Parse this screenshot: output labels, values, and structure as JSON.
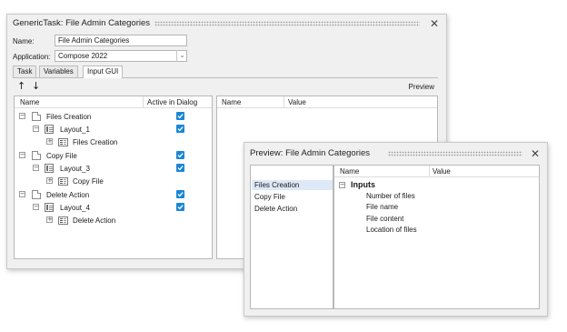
{
  "main_window": {
    "title": "GenericTask: File Admin Categories",
    "name_label": "Name:",
    "name_value": "File Admin Categories",
    "application_label": "Application:",
    "application_value": "Compose 2022",
    "tabs": [
      "Task",
      "Variables",
      "Input GUI"
    ],
    "active_tab": "Input GUI",
    "up_arrow": "↑",
    "down_arrow": "↓",
    "preview_label": "Preview",
    "tree_headers": {
      "name": "Name",
      "active": "Active in Dialog"
    },
    "tree": [
      {
        "label": "Files Creation",
        "checked": true
      },
      {
        "label": "Layout_1",
        "checked": true
      },
      {
        "label": "Files Creation"
      },
      {
        "label": "Copy File",
        "checked": true
      },
      {
        "label": "Layout_3",
        "checked": true
      },
      {
        "label": "Copy File"
      },
      {
        "label": "Delete Action",
        "checked": true
      },
      {
        "label": "Layout_4",
        "checked": true
      },
      {
        "label": "Delete Action"
      }
    ],
    "property_headers": {
      "name": "Name",
      "value": "Value"
    }
  },
  "preview_window": {
    "title": "Preview: File Admin Categories",
    "categories": [
      "Files Creation",
      "Copy File",
      "Delete Action"
    ],
    "selected_category": "Files Creation",
    "table_headers": {
      "name": "Name",
      "value": "Value"
    },
    "group_label": "Inputs",
    "inputs": [
      "Number of files",
      "File name",
      "File content",
      "Location of files"
    ]
  },
  "colors": {
    "accent": "#1c86d6",
    "selection": "#dde9f6"
  }
}
